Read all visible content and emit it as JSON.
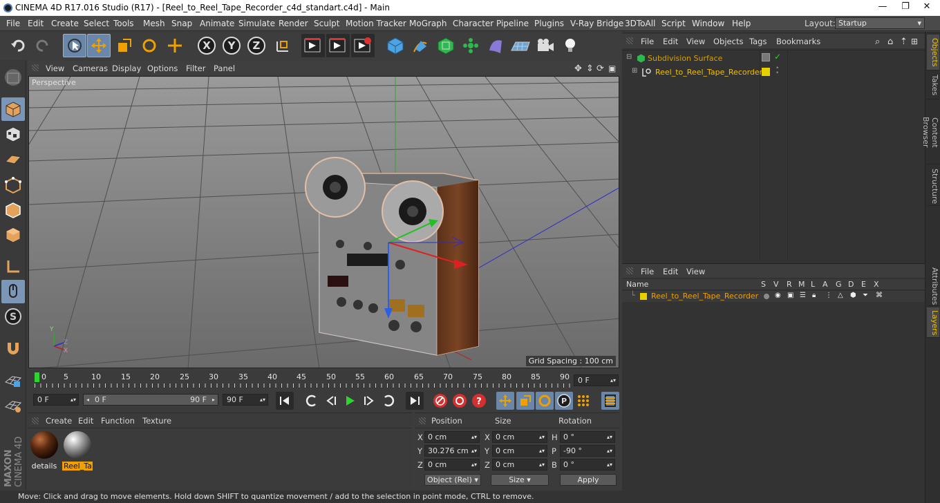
{
  "app": {
    "title": "CINEMA 4D R17.016 Studio (R17) - [Reel_to_Reel_Tape_Recorder_c4d_standart.c4d] - Main",
    "window_buttons": [
      "—",
      "❐",
      "✕"
    ]
  },
  "menubar": {
    "items": [
      "File",
      "Edit",
      "Create",
      "Select",
      "Tools",
      "Mesh",
      "Snap",
      "Animate",
      "Simulate",
      "Render",
      "Sculpt",
      "Motion Tracker",
      "MoGraph",
      "Character",
      "Pipeline",
      "Plugins",
      "V-Ray Bridge",
      "3DToAll",
      "Script",
      "Window",
      "Help"
    ],
    "layout_label": "Layout:",
    "layout_value": "Startup"
  },
  "viewport": {
    "menu": [
      "View",
      "Cameras",
      "Display",
      "Options",
      "Filter",
      "Panel"
    ],
    "label": "Perspective",
    "grid_spacing": "Grid Spacing : 100 cm",
    "axis_labels": {
      "y": "Y",
      "z": "Z",
      "x": "X"
    }
  },
  "timeline": {
    "ticks": [
      "0",
      "5",
      "10",
      "15",
      "20",
      "25",
      "30",
      "35",
      "40",
      "45",
      "50",
      "55",
      "60",
      "65",
      "70",
      "75",
      "80",
      "85",
      "90"
    ],
    "end_field": "0 F"
  },
  "transport": {
    "current_frame": "0 F",
    "range_start": "0 F",
    "range_end": "90 F",
    "max_frame": "90 F"
  },
  "materials": {
    "menu": [
      "Create",
      "Edit",
      "Function",
      "Texture"
    ],
    "items": [
      {
        "name": "details",
        "selected": false
      },
      {
        "name": "Reel_Ta",
        "selected": true
      }
    ]
  },
  "coordinates": {
    "headers": {
      "position": "Position",
      "size": "Size",
      "rotation": "Rotation"
    },
    "rows": [
      {
        "axis": "X",
        "pos": "0 cm",
        "size_axis": "X",
        "size": "0 cm",
        "rot_axis": "H",
        "rot": "0 °"
      },
      {
        "axis": "Y",
        "pos": "30.276 cm",
        "size_axis": "Y",
        "size": "0 cm",
        "rot_axis": "P",
        "rot": "-90 °"
      },
      {
        "axis": "Z",
        "pos": "0 cm",
        "size_axis": "Z",
        "size": "0 cm",
        "rot_axis": "B",
        "rot": "0 °"
      }
    ],
    "mode_select": "Object (Rel)",
    "size_select": "Size",
    "apply": "Apply"
  },
  "status": "Move: Click and drag to move elements. Hold down SHIFT to quantize movement / add to the selection in point mode, CTRL to remove.",
  "object_manager": {
    "menu": [
      "File",
      "Edit",
      "View",
      "Objects",
      "Tags",
      "Bookmarks"
    ],
    "objects": [
      {
        "name": "Subdivision Surface",
        "color": "#d4a000"
      },
      {
        "name": "Reel_to_Reel_Tape_Recorder",
        "color": "#f0c000"
      }
    ]
  },
  "layer_manager": {
    "menu": [
      "File",
      "Edit",
      "View"
    ],
    "columns": [
      "Name",
      "S",
      "V",
      "R",
      "M",
      "L",
      "A",
      "G",
      "D",
      "E",
      "X"
    ],
    "layers": [
      {
        "name": "Reel_to_Reel_Tape_Recorder",
        "color": "#e8d000"
      }
    ]
  },
  "right_tabs": [
    "Objects",
    "Takes",
    "Content Browser",
    "Structure",
    "Attributes",
    "Layers"
  ],
  "branding": {
    "maxon": "MAXON",
    "product": "CINEMA 4D"
  },
  "colors": {
    "accent_orange": "#f0a000",
    "highlight_yellow": "#f0c000",
    "selection_blue": "#6a86a8"
  }
}
